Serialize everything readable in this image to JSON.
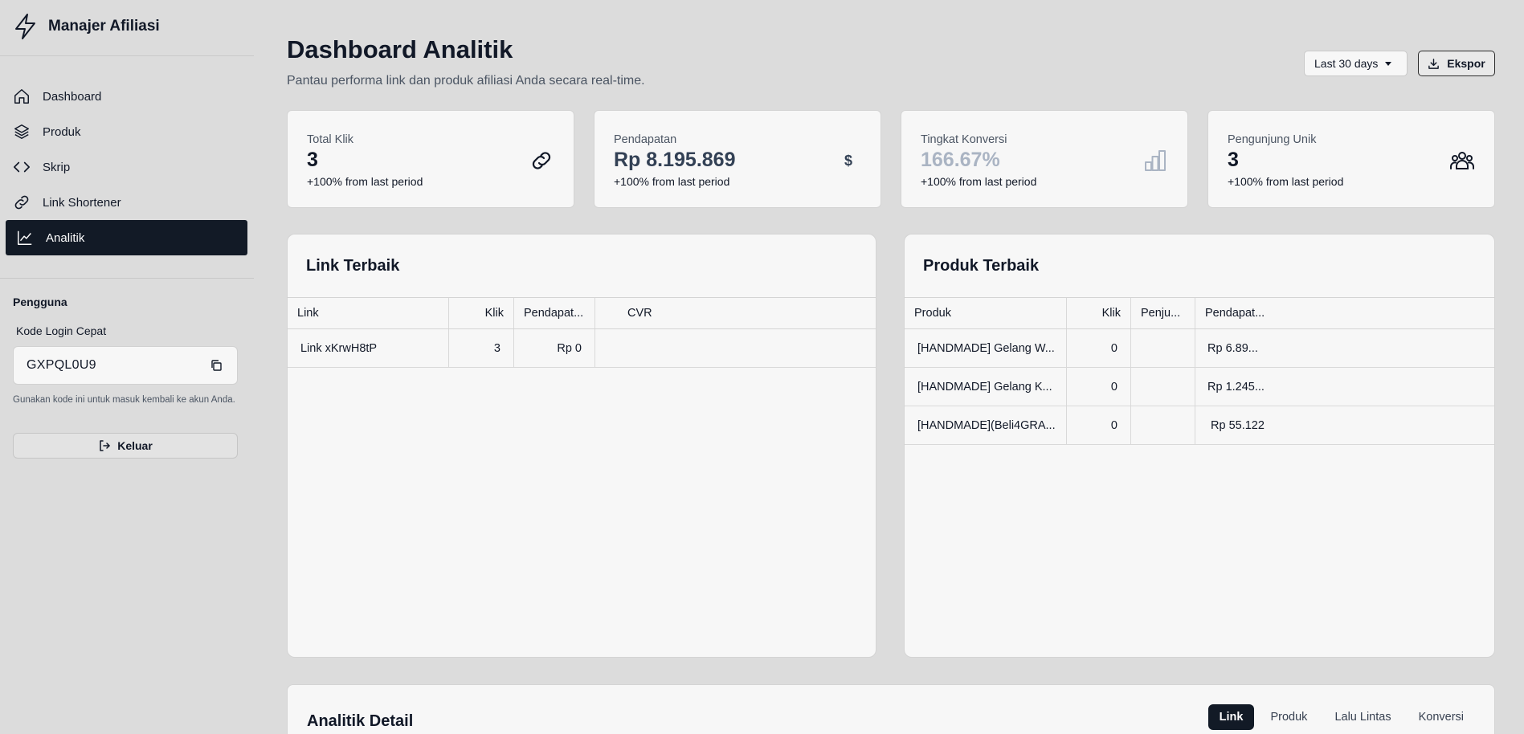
{
  "app": {
    "name": "Manajer Afiliasi"
  },
  "sidebar": {
    "items": [
      {
        "label": "Dashboard",
        "icon": "home-icon",
        "active": false
      },
      {
        "label": "Produk",
        "icon": "layers-icon",
        "active": false
      },
      {
        "label": "Skrip",
        "icon": "code-icon",
        "active": false
      },
      {
        "label": "Link Shortener",
        "icon": "link-icon",
        "active": false
      },
      {
        "label": "Analitik",
        "icon": "chart-line-icon",
        "active": true
      }
    ],
    "user_section_title": "Pengguna",
    "login_code_label": "Kode Login Cepat",
    "login_code": "GXPQL0U9",
    "login_code_hint": "Gunakan kode ini untuk masuk kembali ke akun Anda.",
    "logout_label": "Keluar"
  },
  "header": {
    "title": "Dashboard Analitik",
    "subtitle": "Pantau performa link dan produk afiliasi Anda secara real-time.",
    "range_select": "Last 30 days",
    "export_label": "Ekspor"
  },
  "stats": [
    {
      "label": "Total Klik",
      "value": "3",
      "delta": "+100% from last period",
      "icon": "link-icon"
    },
    {
      "label": "Pendapatan",
      "value": "Rp 8.195.869",
      "delta": "+100% from last period",
      "icon": "dollar-icon"
    },
    {
      "label": "Tingkat Konversi",
      "value": "166.67%",
      "delta": "+100% from last period",
      "icon": "bar-chart-icon"
    },
    {
      "label": "Pengunjung Unik",
      "value": "3",
      "delta": "+100% from last period",
      "icon": "users-icon"
    }
  ],
  "top_links": {
    "title": "Link Terbaik",
    "columns": [
      "Link",
      "Klik",
      "Pendapat...",
      "CVR"
    ],
    "rows": [
      [
        "Link xKrwH8tP",
        "3",
        "Rp 0",
        ""
      ]
    ]
  },
  "top_products": {
    "title": "Produk Terbaik",
    "columns": [
      "Produk",
      "Klik",
      "Penju...",
      "Pendapat..."
    ],
    "rows": [
      [
        "[HANDMADE] Gelang W...",
        "0",
        "",
        "Rp 6.89..."
      ],
      [
        "[HANDMADE] Gelang K...",
        "0",
        "",
        "Rp 1.245..."
      ],
      [
        "[HANDMADE](Beli4GRA...",
        "0",
        "",
        "Rp 55.122"
      ]
    ]
  },
  "detail": {
    "title": "Analitik Detail",
    "tabs": [
      "Link",
      "Produk",
      "Lalu Lintas",
      "Konversi"
    ],
    "active_tab": "Link"
  },
  "colors": {
    "active_nav": "#121a26",
    "accent_muted": "#aab4c3",
    "value_dark": "#334155"
  }
}
